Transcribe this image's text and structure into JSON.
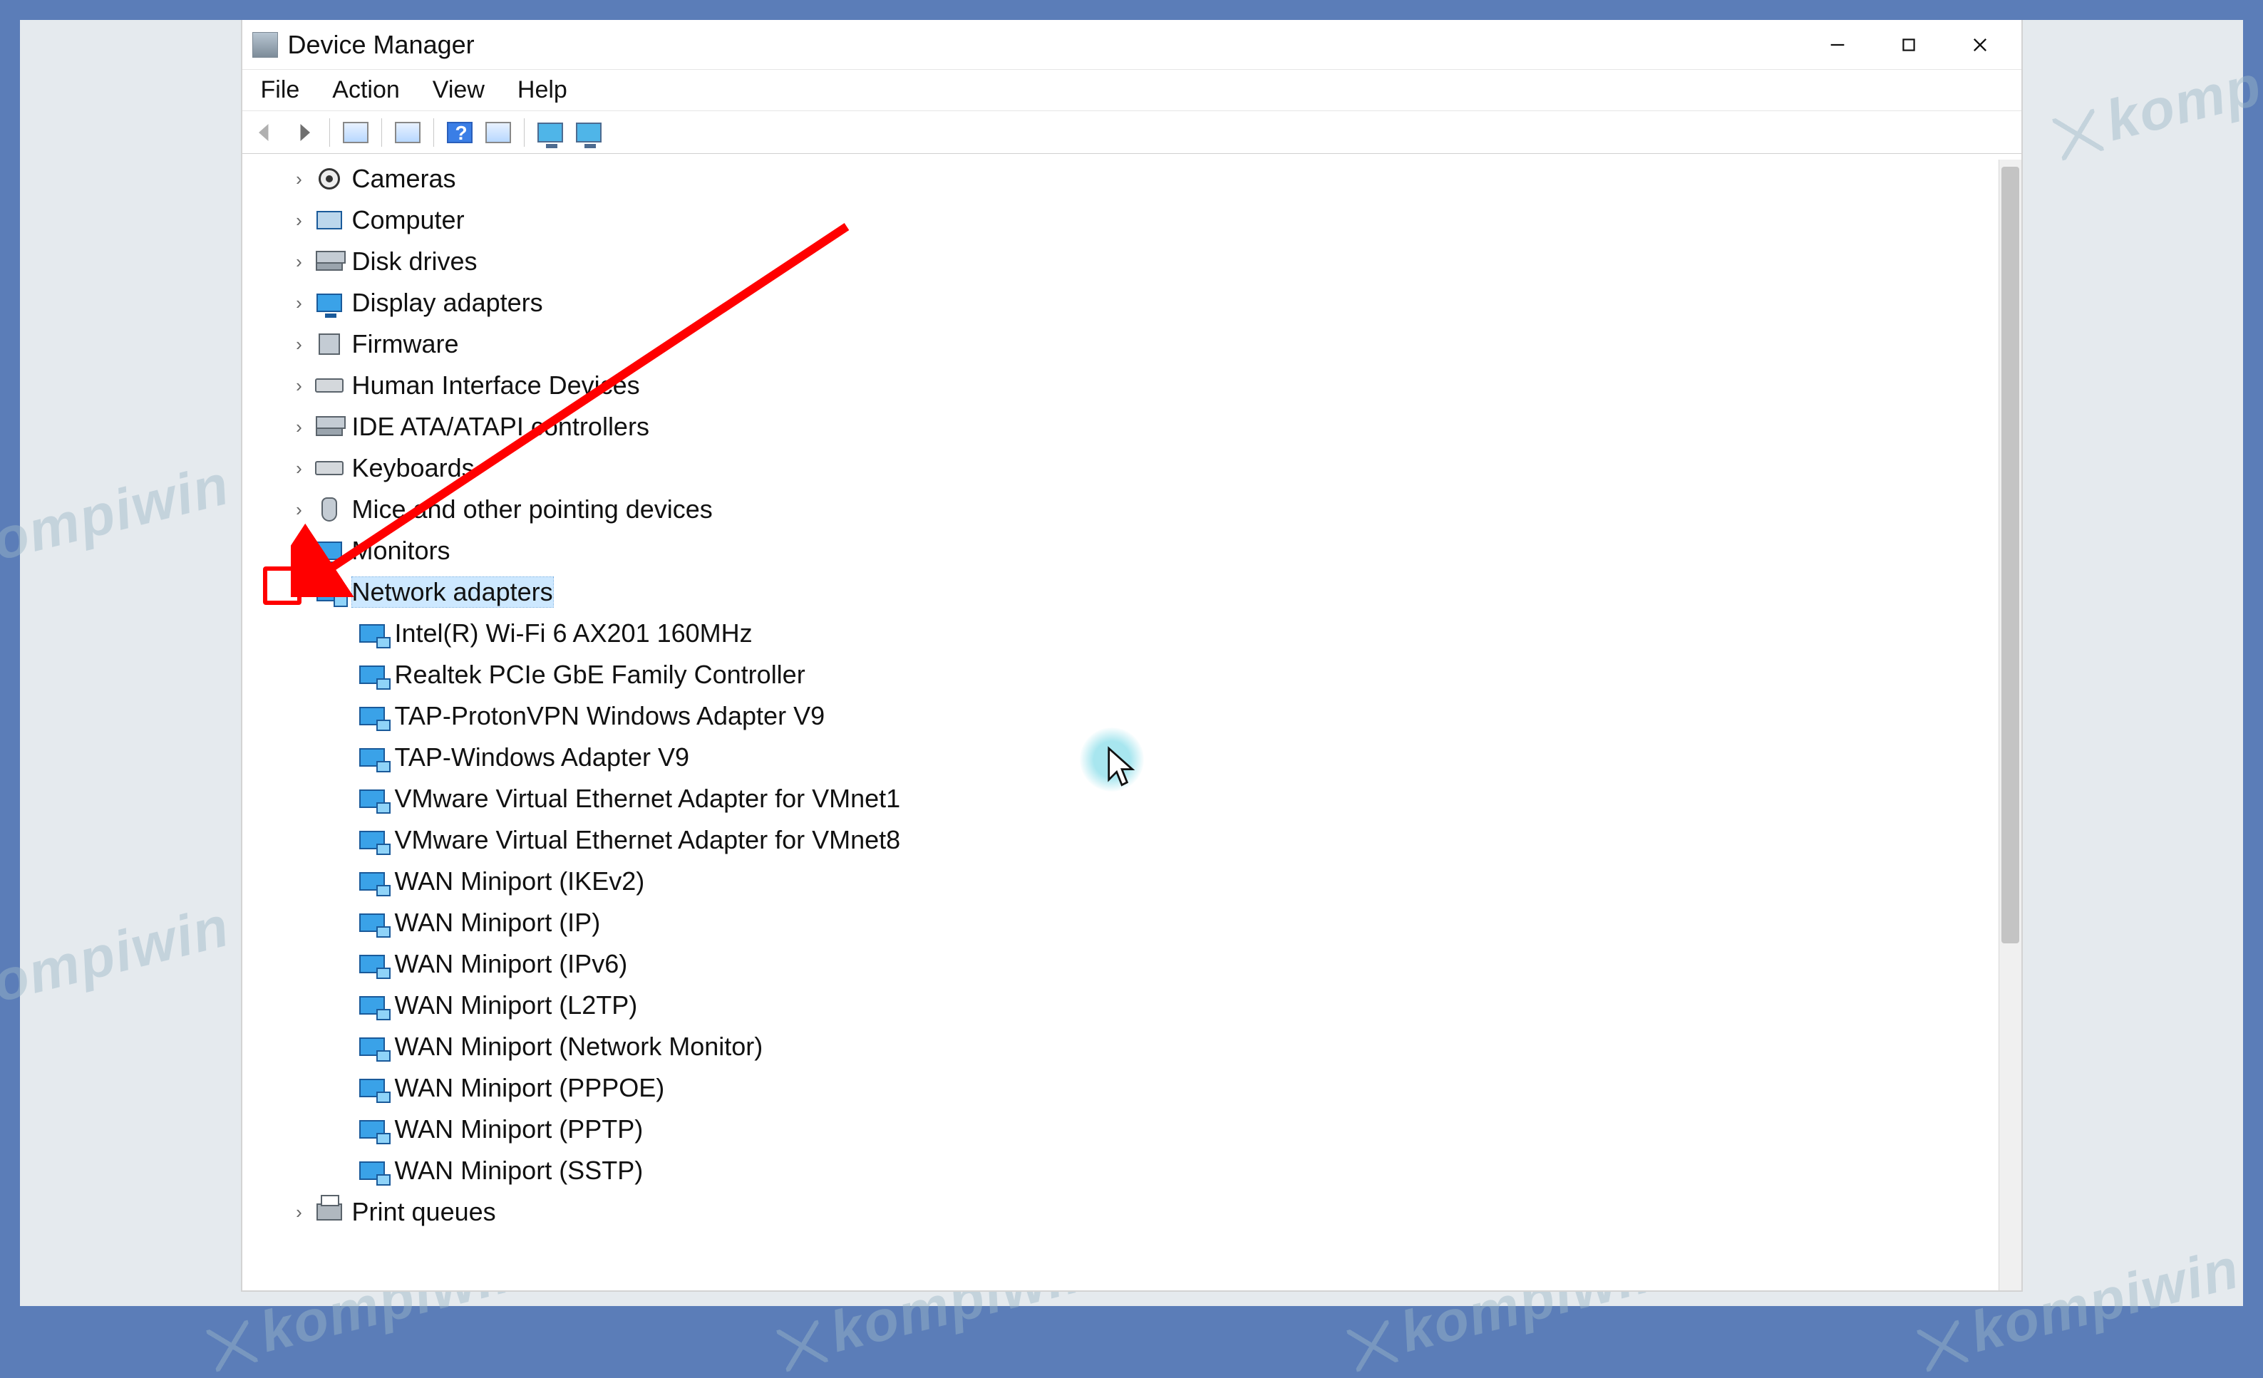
{
  "watermark_text": "kompiwin",
  "window": {
    "title": "Device Manager"
  },
  "menubar": {
    "items": [
      "File",
      "Action",
      "View",
      "Help"
    ]
  },
  "toolbar": {
    "back": "back-icon",
    "forward": "forward-icon",
    "prop_window": "properties-icon",
    "refresh": "refresh-icon",
    "help": "help-icon",
    "scan": "scan-hardware-icon",
    "add": "add-hardware-icon",
    "monitor": "monitor-icon"
  },
  "tree": {
    "collapsed": [
      {
        "label": "Cameras",
        "icon": "camera"
      },
      {
        "label": "Computer",
        "icon": "computer"
      },
      {
        "label": "Disk drives",
        "icon": "disk"
      },
      {
        "label": "Display adapters",
        "icon": "monitor"
      },
      {
        "label": "Firmware",
        "icon": "chip"
      },
      {
        "label": "Human Interface Devices",
        "icon": "hid"
      },
      {
        "label": "IDE ATA/ATAPI controllers",
        "icon": "disk"
      },
      {
        "label": "Keyboards",
        "icon": "keyboard"
      },
      {
        "label": "Mice and other pointing devices",
        "icon": "mouse"
      },
      {
        "label": "Monitors",
        "icon": "monitor"
      }
    ],
    "expanded": {
      "label": "Network adapters",
      "icon": "net",
      "children": [
        "Intel(R) Wi-Fi 6 AX201 160MHz",
        "Realtek PCIe GbE Family Controller",
        "TAP-ProtonVPN Windows Adapter V9",
        "TAP-Windows Adapter V9",
        "VMware Virtual Ethernet Adapter for VMnet1",
        "VMware Virtual Ethernet Adapter for VMnet8",
        "WAN Miniport (IKEv2)",
        "WAN Miniport (IP)",
        "WAN Miniport (IPv6)",
        "WAN Miniport (L2TP)",
        "WAN Miniport (Network Monitor)",
        "WAN Miniport (PPPOE)",
        "WAN Miniport (PPTP)",
        "WAN Miniport (SSTP)"
      ]
    },
    "after": [
      {
        "label": "Print queues",
        "icon": "printer"
      }
    ]
  }
}
